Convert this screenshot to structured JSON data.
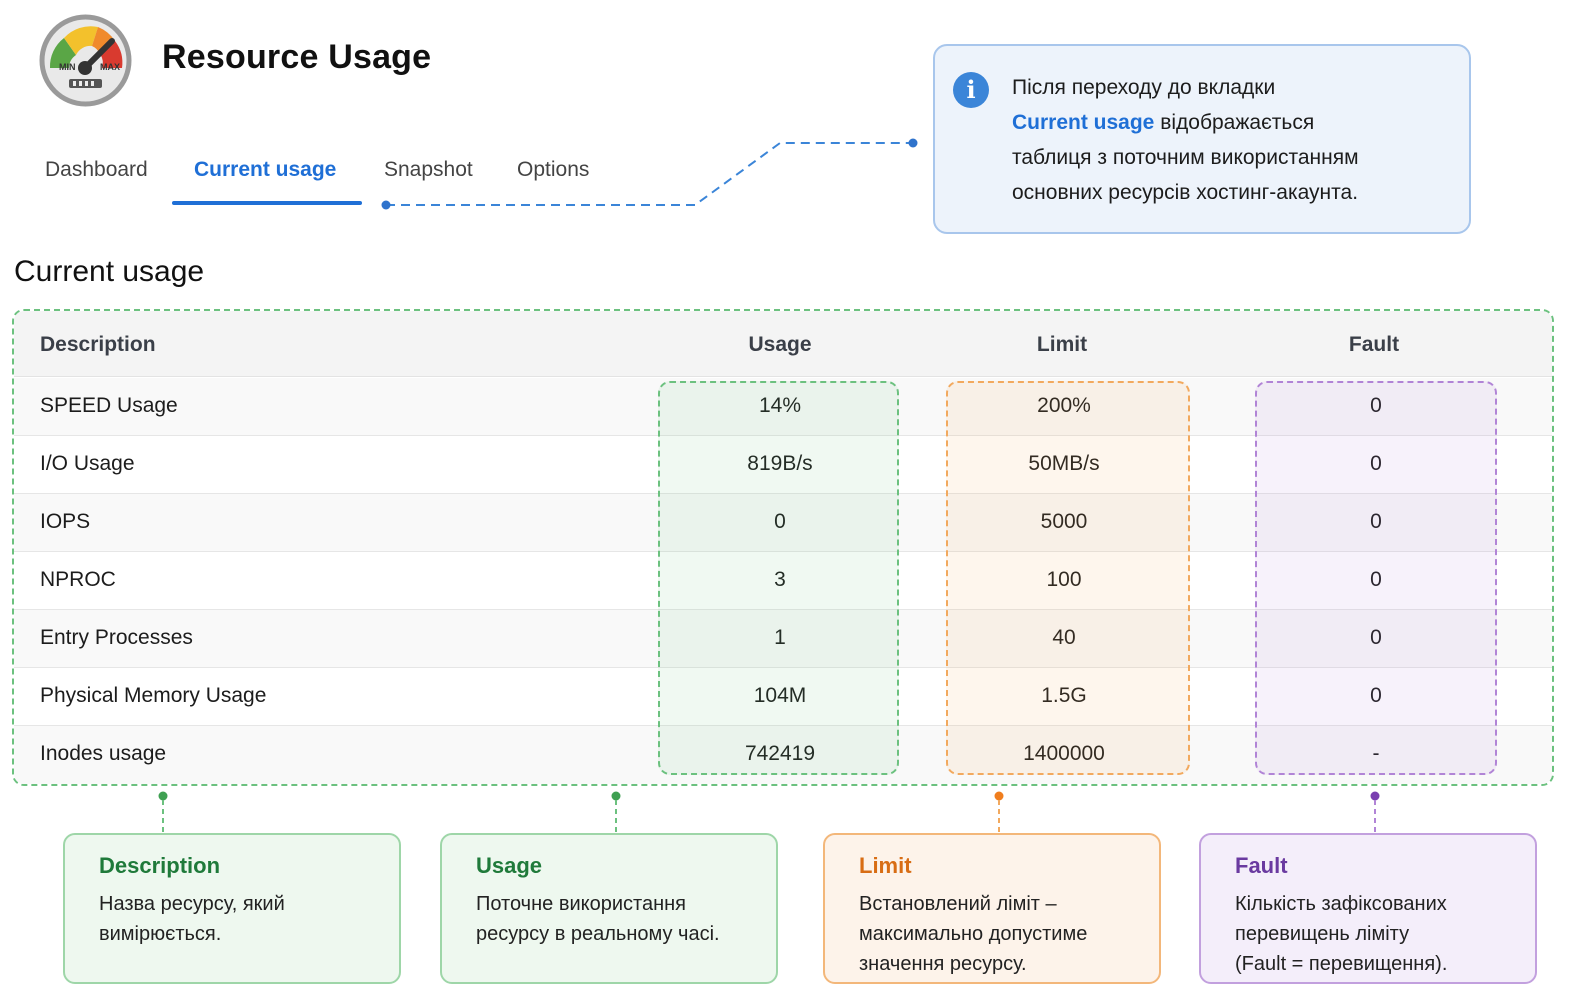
{
  "app": {
    "title": "Resource Usage"
  },
  "logo": {
    "min_label": "MIN",
    "max_label": "MAX",
    "icon": "gauge-icon"
  },
  "tabs": [
    {
      "label": "Dashboard",
      "active": false
    },
    {
      "label": "Current usage",
      "active": true
    },
    {
      "label": "Snapshot",
      "active": false
    },
    {
      "label": "Options",
      "active": false
    }
  ],
  "callout": {
    "line1": "Після переходу до вкладки",
    "highlight": "Current usage",
    "line2": "відображається",
    "line3": "таблиця з поточним використанням",
    "line4": "основних ресурсів хостинг-акаунта."
  },
  "section": {
    "title": "Current usage"
  },
  "table": {
    "headers": {
      "description": "Description",
      "usage": "Usage",
      "limit": "Limit",
      "fault": "Fault"
    },
    "rows": [
      {
        "description": "SPEED Usage",
        "usage": "14%",
        "limit": "200%",
        "fault": "0"
      },
      {
        "description": "I/O Usage",
        "usage": "819B/s",
        "limit": "50MB/s",
        "fault": "0"
      },
      {
        "description": "IOPS",
        "usage": "0",
        "limit": "5000",
        "fault": "0"
      },
      {
        "description": "NPROC",
        "usage": "3",
        "limit": "100",
        "fault": "0"
      },
      {
        "description": "Entry Processes",
        "usage": "1",
        "limit": "40",
        "fault": "0"
      },
      {
        "description": "Physical Memory Usage",
        "usage": "104M",
        "limit": "1.5G",
        "fault": "0"
      },
      {
        "description": "Inodes usage",
        "usage": "742419",
        "limit": "1400000",
        "fault": "-"
      }
    ]
  },
  "legend": {
    "description": {
      "title": "Description",
      "text1": "Назва ресурсу, який",
      "text2": "вимірюється."
    },
    "usage": {
      "title": "Usage",
      "text1": "Поточне використання",
      "text2": "ресурсу в реальному часі."
    },
    "limit": {
      "title": "Limit",
      "text1": "Встановлений ліміт –",
      "text2": "максимально допустиме",
      "text3": "значення ресурсу."
    },
    "fault": {
      "title": "Fault",
      "text1": "Кількість зафіксованих",
      "text2": "перевищень ліміту",
      "text3": "(Fault = перевищення)."
    }
  },
  "colors": {
    "accent": "#1f6fd6",
    "green": "#6cc17f",
    "orange": "#f2a95e",
    "purple": "#b184d6"
  }
}
